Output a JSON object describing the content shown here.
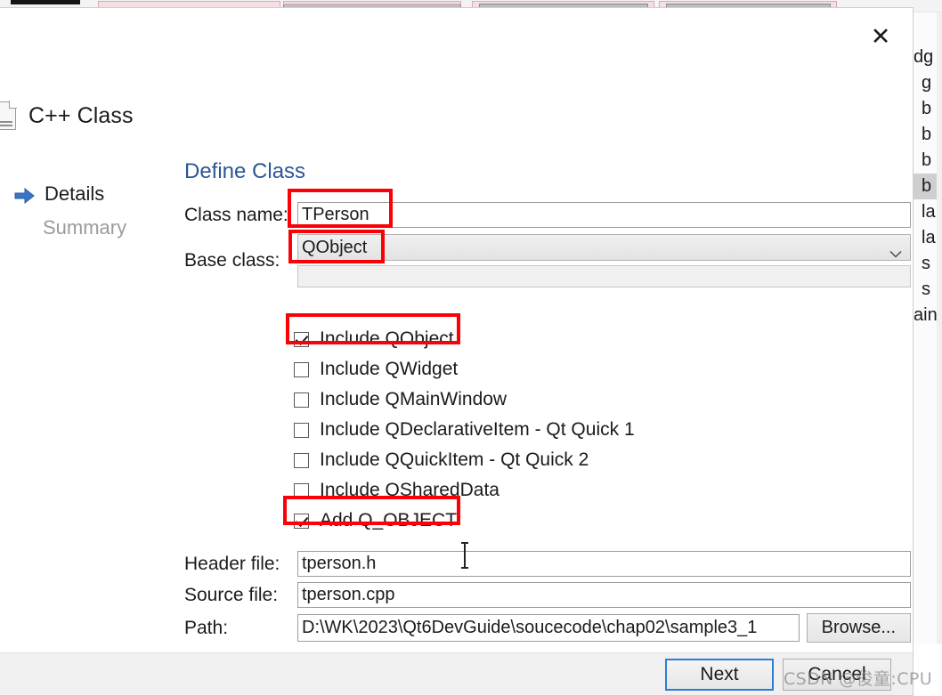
{
  "dialog": {
    "title": "C++ Class",
    "close_label": "✕",
    "pane_title": "Define Class"
  },
  "nav": {
    "items": [
      {
        "label": "Details",
        "state": "current"
      },
      {
        "label": "Summary",
        "state": "upcoming"
      }
    ]
  },
  "form": {
    "class_name": {
      "label": "Class name:",
      "value": "TPerson"
    },
    "base_class": {
      "label": "Base class:",
      "value": "QObject"
    }
  },
  "options": [
    {
      "label": "Include QObject",
      "checked": true
    },
    {
      "label": "Include QWidget",
      "checked": false
    },
    {
      "label": "Include QMainWindow",
      "checked": false
    },
    {
      "label": "Include QDeclarativeItem - Qt Quick 1",
      "checked": false
    },
    {
      "label": "Include QQuickItem - Qt Quick 2",
      "checked": false
    },
    {
      "label": "Include QSharedData",
      "checked": false
    },
    {
      "label": "Add Q_OBJECT",
      "checked": true
    }
  ],
  "files": {
    "header": {
      "label": "Header file:",
      "value": "tperson.h"
    },
    "source": {
      "label": "Source file:",
      "value": "tperson.cpp"
    },
    "path": {
      "label": "Path:",
      "value": "D:\\WK\\2023\\Qt6DevGuide\\soucecode\\chap02\\sample3_1"
    },
    "browse_label": "Browse..."
  },
  "footer": {
    "next_label": "Next",
    "cancel_label": "Cancel"
  },
  "watermark": {
    "text": "CSDN @俊童:CPU"
  },
  "background": {
    "lines": [
      "dg",
      "g",
      "b",
      "b",
      "b",
      "b",
      "la",
      "la",
      "s",
      "s",
      "ain"
    ]
  },
  "colors": {
    "accent_blue": "#2b5797",
    "annotation_red": "#fb0006",
    "default_button_border": "#2a7fd4",
    "disabled_text": "#9b9b9b"
  }
}
